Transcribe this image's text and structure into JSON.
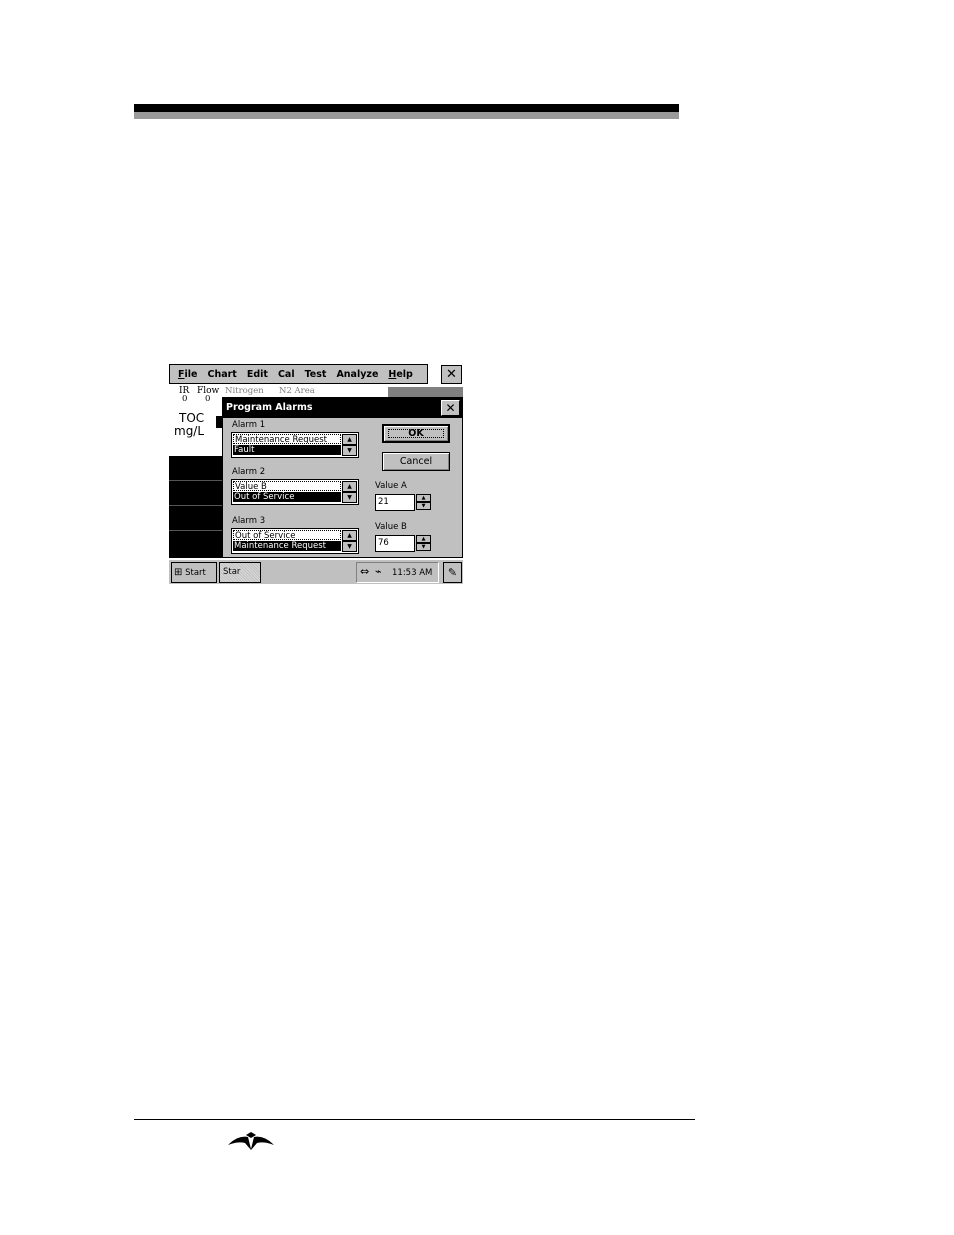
{
  "menu": [
    "File",
    "Chart",
    "Edit",
    "Cal",
    "Test",
    "Analyze",
    "Help"
  ],
  "app_close": "✕",
  "status": {
    "ir_label": "IR",
    "flow_label": "Flow",
    "ir_value": "0",
    "flow_value": "0",
    "nitrogen_label": "Nitrogen",
    "n2_label": "N2 Area"
  },
  "main": {
    "toc_label": "TOC",
    "unit_label": "mg/L"
  },
  "dialog": {
    "title": "Program Alarms",
    "close": "✕",
    "alarm1": {
      "label": "Alarm 1",
      "items": [
        "Maintenance Request",
        "Fault"
      ]
    },
    "alarm2": {
      "label": "Alarm 2",
      "items": [
        "Value B",
        "Out of Service"
      ]
    },
    "alarm3": {
      "label": "Alarm 3",
      "items": [
        "Out of Service",
        "Maintenance Request"
      ]
    },
    "ok_label": "OK",
    "cancel_label": "Cancel",
    "value_a": {
      "label": "Value A",
      "value": "21"
    },
    "value_b": {
      "label": "Value B",
      "value": "76"
    }
  },
  "taskbar": {
    "start_label": "Start",
    "task_label": "Star",
    "clock": "11:53 AM"
  }
}
